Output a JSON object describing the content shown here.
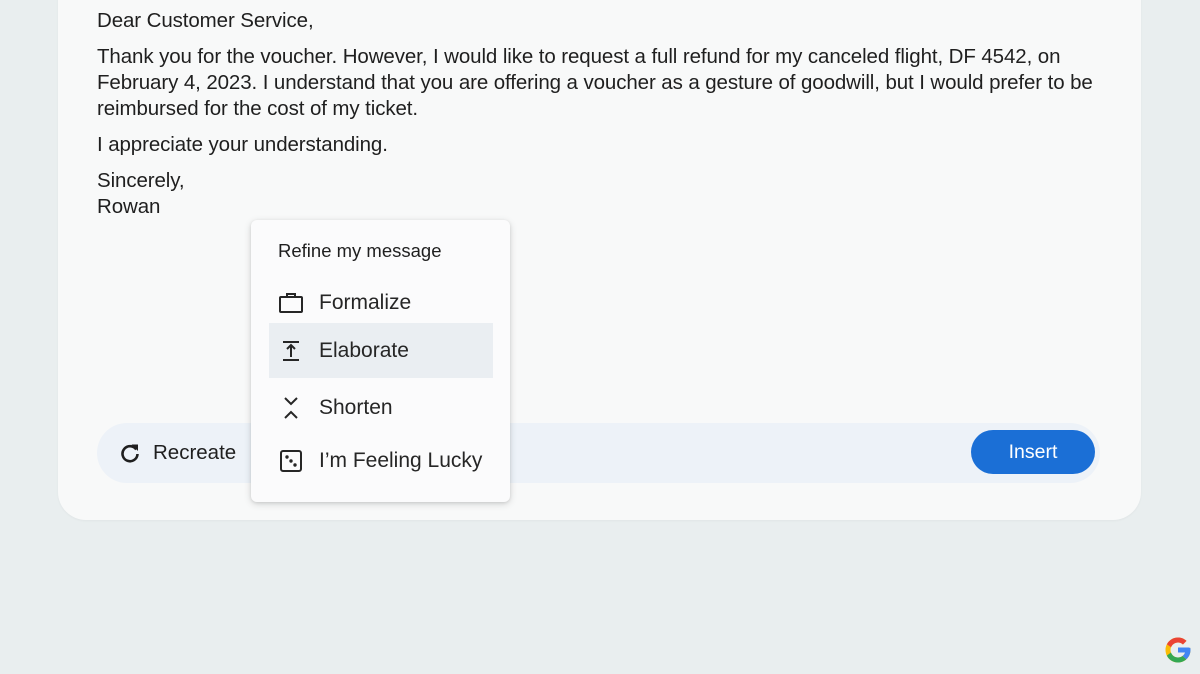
{
  "email": {
    "greeting": "Dear Customer Service,",
    "paragraph": "Thank you for the voucher. However, I would like to request a full refund for my canceled flight, DF 4542, on February 4, 2023. I understand that you are offering a voucher as a gesture of goodwill, but I would prefer to be reimbursed for the cost of my ticket.",
    "appreciation": "I appreciate your understanding.",
    "closing": "Sincerely,",
    "signature": "Rowan"
  },
  "actions": {
    "recreate_label": "Recreate",
    "insert_label": "Insert"
  },
  "refine_menu": {
    "title": "Refine my message",
    "items": [
      {
        "label": "Formalize",
        "icon": "briefcase-icon"
      },
      {
        "label": "Elaborate",
        "icon": "expand-vertical-icon",
        "highlighted": true
      },
      {
        "label": "Shorten",
        "icon": "collapse-vertical-icon"
      },
      {
        "label": "I’m Feeling Lucky",
        "icon": "dice-icon"
      }
    ]
  },
  "colors": {
    "primary": "#1b6fd6",
    "page_bg": "#e9eeef",
    "card_bg": "#f8f9f9",
    "action_bar_bg": "#edf2f8",
    "menu_highlight": "#eaeef2"
  }
}
